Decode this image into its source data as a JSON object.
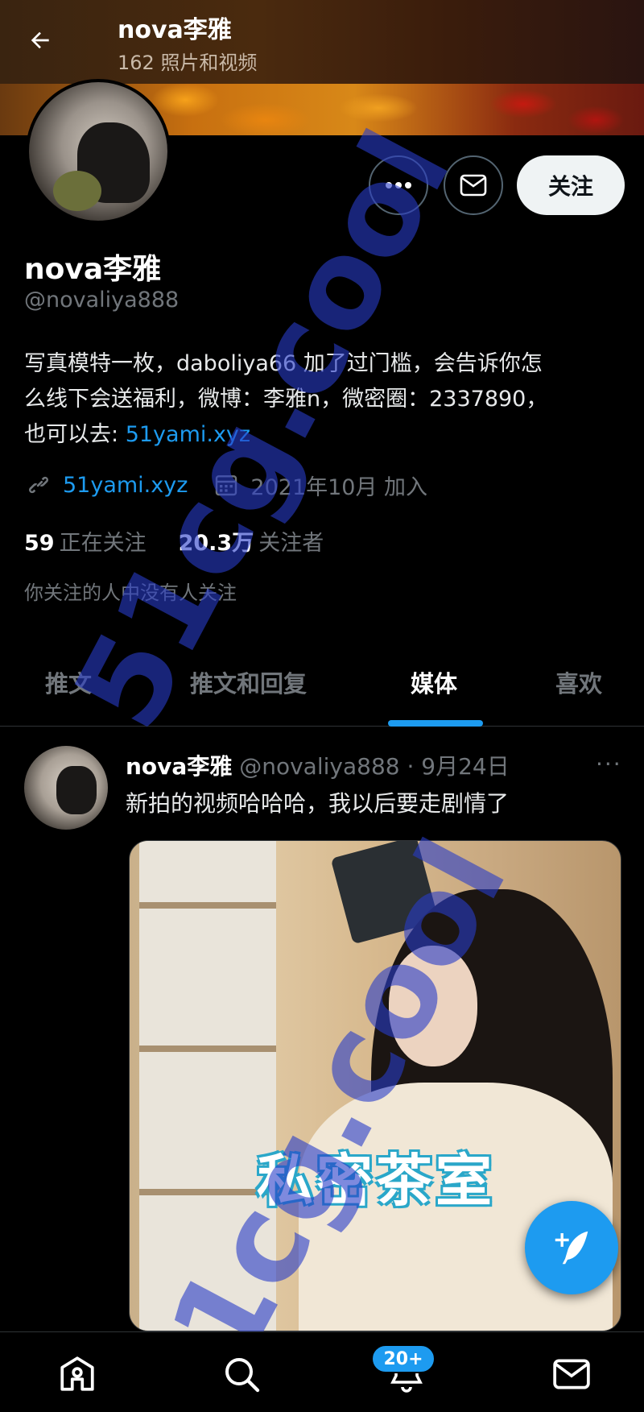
{
  "header": {
    "title": "nova李雅",
    "subtitle": "162 照片和视频"
  },
  "profile": {
    "name": "nova李雅",
    "handle": "@novaliya888",
    "bio_line1": "写真模特一枚，daboliya66 加了过门槛，会告诉你怎",
    "bio_line2": "么线下会送福利，微博：李雅n，微密圈：2337890，",
    "bio_line3_prefix": "也可以去: ",
    "bio_link": "51yami.xyz",
    "website": "51yami.xyz",
    "joined": "2021年10月 加入",
    "following_count": "59",
    "following_label": "正在关注",
    "followers_count": "20.3万",
    "followers_label": "关注者",
    "mutual_note": "你关注的人中没有人关注",
    "follow_button": "关注"
  },
  "tabs": [
    {
      "label": "推文"
    },
    {
      "label": "推文和回复"
    },
    {
      "label": "媒体"
    },
    {
      "label": "喜欢"
    }
  ],
  "active_tab": "媒体",
  "tweet": {
    "name": "nova李雅",
    "handle": "@novaliya888",
    "date": "· 9月24日",
    "more": "···",
    "text": "新拍的视频哈哈哈，我以后要走剧情了",
    "media_caption": "私密茶室"
  },
  "bottom_nav": {
    "notifications_badge": "20+",
    "icons": [
      "home-icon",
      "search-icon",
      "bell-icon",
      "mail-icon"
    ]
  },
  "watermark": "51cg.cool",
  "colors": {
    "accent": "#1d9bf0",
    "background": "#000000",
    "muted_text": "#71767b"
  }
}
